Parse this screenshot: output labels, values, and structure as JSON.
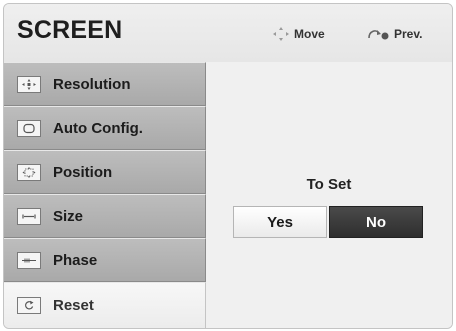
{
  "header": {
    "title": "SCREEN",
    "move_hint": "Move",
    "prev_hint": "Prev."
  },
  "menu": {
    "items": [
      {
        "label": "Resolution",
        "icon": "resolution-icon"
      },
      {
        "label": "Auto Config.",
        "icon": "auto-config-icon"
      },
      {
        "label": "Position",
        "icon": "position-icon"
      },
      {
        "label": "Size",
        "icon": "size-icon"
      },
      {
        "label": "Phase",
        "icon": "phase-icon"
      },
      {
        "label": "Reset",
        "icon": "reset-icon",
        "selected": true
      }
    ]
  },
  "dialog": {
    "prompt": "To Set",
    "yes_label": "Yes",
    "no_label": "No",
    "focused": "No"
  },
  "colors": {
    "menu_item_bg": "#b3b3b3",
    "selected_item_bg": "#f2f2f2",
    "focused_button_bg": "#3a3a3a"
  }
}
